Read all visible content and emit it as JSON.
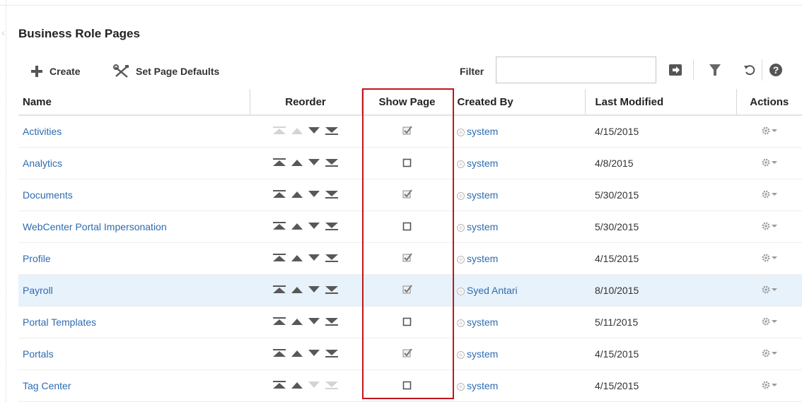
{
  "page": {
    "title": "Business Role Pages"
  },
  "toolbar": {
    "create_label": "Create",
    "defaults_label": "Set Page Defaults",
    "filter_label": "Filter",
    "filter_value": ""
  },
  "table": {
    "headers": {
      "name": "Name",
      "reorder": "Reorder",
      "show_page": "Show Page",
      "created_by": "Created By",
      "last_modified": "Last Modified",
      "actions": "Actions"
    },
    "rows": [
      {
        "name": "Activities",
        "show": true,
        "created_by": "system",
        "modified": "4/15/2015",
        "reorder_disabled": [
          "top",
          "up"
        ],
        "selected": false
      },
      {
        "name": "Analytics",
        "show": false,
        "created_by": "system",
        "modified": "4/8/2015",
        "reorder_disabled": [],
        "selected": false
      },
      {
        "name": "Documents",
        "show": true,
        "created_by": "system",
        "modified": "5/30/2015",
        "reorder_disabled": [],
        "selected": false
      },
      {
        "name": "WebCenter Portal Impersonation",
        "show": false,
        "created_by": "system",
        "modified": "5/30/2015",
        "reorder_disabled": [],
        "selected": false
      },
      {
        "name": "Profile",
        "show": true,
        "created_by": "system",
        "modified": "4/15/2015",
        "reorder_disabled": [],
        "selected": false
      },
      {
        "name": "Payroll",
        "show": true,
        "created_by": "Syed Antari",
        "modified": "8/10/2015",
        "reorder_disabled": [],
        "selected": true
      },
      {
        "name": "Portal Templates",
        "show": false,
        "created_by": "system",
        "modified": "5/11/2015",
        "reorder_disabled": [],
        "selected": false
      },
      {
        "name": "Portals",
        "show": true,
        "created_by": "system",
        "modified": "4/15/2015",
        "reorder_disabled": [],
        "selected": false
      },
      {
        "name": "Tag Center",
        "show": false,
        "created_by": "system",
        "modified": "4/15/2015",
        "reorder_disabled": [
          "down",
          "bottom"
        ],
        "selected": false
      }
    ]
  },
  "icons": {
    "create": "plus-icon",
    "defaults": "tools-icon",
    "filter_go": "arrow-right-icon",
    "filter_funnel": "funnel-icon",
    "refresh": "refresh-icon",
    "help": "help-icon",
    "actions": "gear-icon"
  },
  "colors": {
    "link": "#2e6bb0",
    "selected_row": "#e8f2fb",
    "highlight": "#c0151c"
  }
}
